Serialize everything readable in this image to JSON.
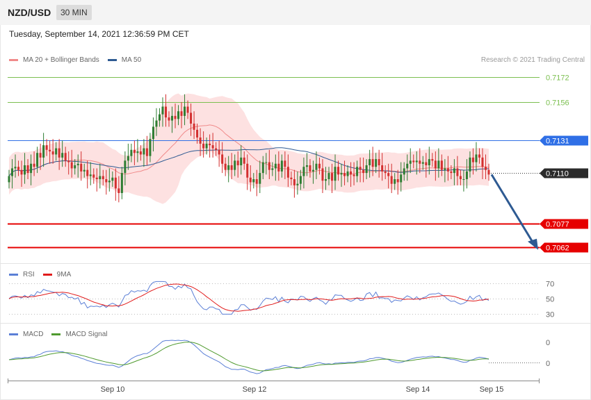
{
  "header": {
    "symbol": "NZD/USD",
    "timeframe": "30 MIN"
  },
  "datetime": "Tuesday, September 14, 2021 12:36:59 PM CET",
  "legend": {
    "main": [
      {
        "label": "MA 20 + Bollinger Bands",
        "color": "#f08a8a"
      },
      {
        "label": "MA 50",
        "color": "#2e5a92"
      }
    ],
    "rsi": [
      {
        "label": "RSI",
        "color": "#5b7fd6"
      },
      {
        "label": "9MA",
        "color": "#e11b1b"
      }
    ],
    "macd": [
      {
        "label": "MACD",
        "color": "#5b7fd6"
      },
      {
        "label": "MACD Signal",
        "color": "#4f9a2e"
      }
    ]
  },
  "credit": "Research © 2021 Trading Central",
  "chart_data": [
    {
      "type": "candlestick",
      "pair": "NZD/USD",
      "timeframe": "30 MIN",
      "x_labels": [
        "Sep 10",
        "Sep 12",
        "Sep 14",
        "Sep 15"
      ],
      "ylim": [
        0.7052,
        0.7178
      ],
      "current_price": 0.711,
      "levels": [
        {
          "label": "0.7172",
          "value": 0.7172,
          "color": "#7bbf4f",
          "kind": "resistance-light"
        },
        {
          "label": "0.7156",
          "value": 0.7156,
          "color": "#7bbf4f",
          "kind": "resistance-light"
        },
        {
          "label": "0.7131",
          "value": 0.7131,
          "color": "#2f6fe6",
          "kind": "pivot"
        },
        {
          "label": "0.7110",
          "value": 0.711,
          "color": "#2b2b2b",
          "kind": "current"
        },
        {
          "label": "0.7077",
          "value": 0.7077,
          "color": "#e60000",
          "kind": "support"
        },
        {
          "label": "0.7062",
          "value": 0.7062,
          "color": "#e60000",
          "kind": "support"
        }
      ],
      "closes": [
        0.7108,
        0.7113,
        0.7114,
        0.7112,
        0.7109,
        0.7115,
        0.711,
        0.7116,
        0.7114,
        0.7123,
        0.712,
        0.7128,
        0.7125,
        0.7124,
        0.7122,
        0.7126,
        0.712,
        0.7123,
        0.7118,
        0.7117,
        0.7113,
        0.7115,
        0.7116,
        0.7111,
        0.7112,
        0.7108,
        0.7109,
        0.7107,
        0.7106,
        0.7108,
        0.7106,
        0.7104,
        0.7105,
        0.7107,
        0.71,
        0.7097,
        0.711,
        0.7118,
        0.7121,
        0.7125,
        0.7123,
        0.7124,
        0.7122,
        0.7126,
        0.7121,
        0.7132,
        0.714,
        0.7144,
        0.7148,
        0.7153,
        0.7146,
        0.7144,
        0.7147,
        0.7145,
        0.715,
        0.7147,
        0.7153,
        0.7149,
        0.7142,
        0.7138,
        0.7133,
        0.7129,
        0.7126,
        0.7129,
        0.7128,
        0.7126,
        0.7125,
        0.7122,
        0.7116,
        0.7112,
        0.7115,
        0.7112,
        0.7118,
        0.7115,
        0.712,
        0.7116,
        0.7107,
        0.7104,
        0.7106,
        0.7103,
        0.711,
        0.7117,
        0.7117,
        0.7112,
        0.7113,
        0.7116,
        0.7111,
        0.7118,
        0.7114,
        0.7107,
        0.7106,
        0.7102,
        0.7103,
        0.7108,
        0.7114,
        0.7115,
        0.7111,
        0.7112,
        0.7116,
        0.7113,
        0.7105,
        0.7106,
        0.711,
        0.7105,
        0.7114,
        0.7109,
        0.711,
        0.7108,
        0.7111,
        0.7109,
        0.7108,
        0.7114,
        0.7112,
        0.711,
        0.7115,
        0.7119,
        0.7114,
        0.7119,
        0.7115,
        0.7111,
        0.711,
        0.7108,
        0.7103,
        0.7106,
        0.7104,
        0.7109,
        0.7113,
        0.7116,
        0.7118,
        0.7117,
        0.7118,
        0.7116,
        0.7117,
        0.7115,
        0.7119,
        0.7118,
        0.7113,
        0.7118,
        0.7112,
        0.7113,
        0.7111,
        0.711,
        0.7113,
        0.7108,
        0.7106,
        0.7106,
        0.7111,
        0.712,
        0.7117,
        0.7122,
        0.712,
        0.7114,
        0.7112,
        0.7109
      ]
    },
    {
      "type": "line",
      "title": "RSI",
      "levels": [
        70,
        50,
        30
      ],
      "series": [
        {
          "name": "RSI"
        },
        {
          "name": "9MA"
        }
      ]
    },
    {
      "type": "line",
      "title": "MACD",
      "levels": [
        "0",
        "0"
      ],
      "series": [
        {
          "name": "MACD"
        },
        {
          "name": "MACD Signal"
        }
      ]
    }
  ]
}
